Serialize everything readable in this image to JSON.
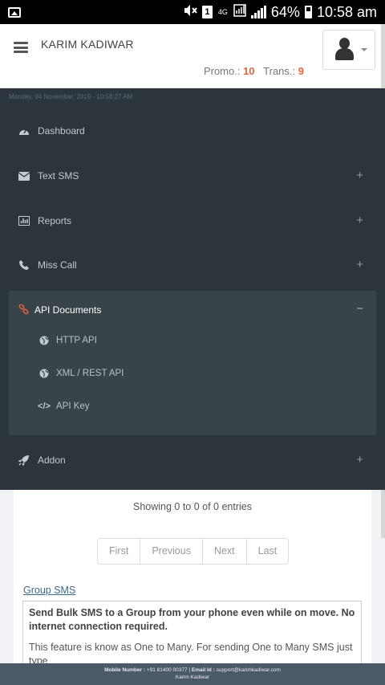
{
  "status_bar": {
    "signal_label": "4G",
    "sim_number": "1",
    "battery": "64%",
    "time": "10:58 am"
  },
  "header": {
    "user_name": "KARIM KADIWAR",
    "promo_label": "Promo.:",
    "promo_count": "10",
    "trans_label": "Trans.:",
    "trans_count": "9"
  },
  "sidebar": {
    "datetime": "Monday, 04 November, 2019 - 10:58:27 AM",
    "items": [
      {
        "label": "Dashboard",
        "icon": "dashboard-icon"
      },
      {
        "label": "Text SMS",
        "icon": "envelope-icon"
      },
      {
        "label": "Reports",
        "icon": "bar-chart-icon"
      },
      {
        "label": "Miss Call",
        "icon": "phone-icon"
      },
      {
        "label": "API Documents",
        "icon": "link-icon"
      },
      {
        "label": "Addon",
        "icon": "rocket-icon"
      }
    ],
    "api_subitems": [
      {
        "label": "HTTP API",
        "icon": "globe-icon"
      },
      {
        "label": "XML / REST API",
        "icon": "globe-icon"
      },
      {
        "label": "API Key",
        "icon": "code-icon"
      }
    ]
  },
  "content": {
    "entries_text": "Showing 0 to 0 of 0 entries",
    "pager": [
      "First",
      "Previous",
      "Next",
      "Last"
    ],
    "group_link": "Group SMS",
    "group_strong": "Send Bulk SMS to a Group from your phone even while on move. No internet connection required.",
    "group_desc": "This feature is know as One to Many. For sending One to Many SMS just type"
  },
  "footer": {
    "mobile_label": "Mobile Number :",
    "mobile_value": "+91 81400 00377",
    "email_label": "Email Id :",
    "email_value": "support@karimkadiwar.com",
    "owner": "Karim Kadiwar"
  },
  "colors": {
    "sidebar_bg": "#2d353c",
    "sidebar_active_bg": "#39434a",
    "accent": "#e4663c",
    "link": "#3b6a8a",
    "footer_bg": "#4c5a68"
  }
}
